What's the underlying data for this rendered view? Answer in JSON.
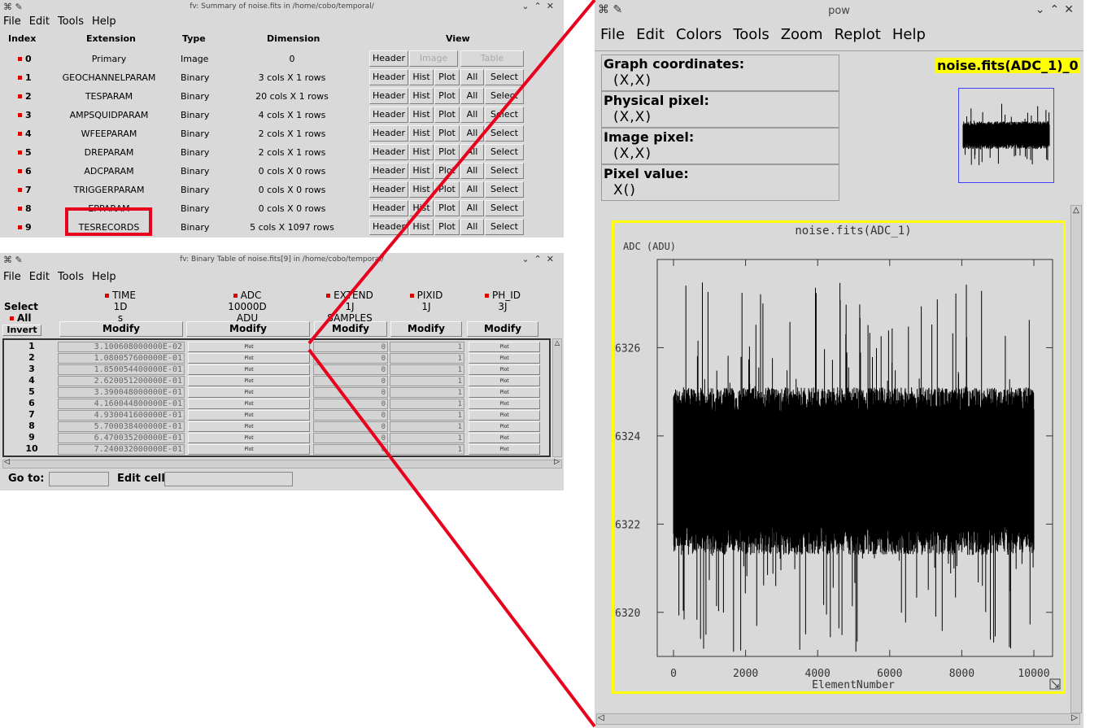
{
  "summary_window": {
    "title": "fv: Summary of noise.fits in /home/cobo/temporal/",
    "menu": [
      "File",
      "Edit",
      "Tools",
      "Help"
    ],
    "headers": {
      "index": "Index",
      "extension": "Extension",
      "type": "Type",
      "dimension": "Dimension",
      "view": "View"
    },
    "rows": [
      {
        "index": "0",
        "extension": "Primary",
        "type": "Image",
        "dimension": "0"
      },
      {
        "index": "1",
        "extension": "GEOCHANNELPARAM",
        "type": "Binary",
        "dimension": "3 cols X 1 rows"
      },
      {
        "index": "2",
        "extension": "TESPARAM",
        "type": "Binary",
        "dimension": "20 cols X 1 rows"
      },
      {
        "index": "3",
        "extension": "AMPSQUIDPARAM",
        "type": "Binary",
        "dimension": "4 cols X 1 rows"
      },
      {
        "index": "4",
        "extension": "WFEEPARAM",
        "type": "Binary",
        "dimension": "2 cols X 1 rows"
      },
      {
        "index": "5",
        "extension": "DREPARAM",
        "type": "Binary",
        "dimension": "2 cols X 1 rows"
      },
      {
        "index": "6",
        "extension": "ADCPARAM",
        "type": "Binary",
        "dimension": "0 cols X 0 rows"
      },
      {
        "index": "7",
        "extension": "TRIGGERPARAM",
        "type": "Binary",
        "dimension": "0 cols X 0 rows"
      },
      {
        "index": "8",
        "extension": "EPPARAM",
        "type": "Binary",
        "dimension": "0 cols X 0 rows"
      },
      {
        "index": "9",
        "extension": "TESRECORDS",
        "type": "Binary",
        "dimension": "5 cols X 1097 rows"
      }
    ],
    "buttons": {
      "header": "Header",
      "image": "Image",
      "table": "Table",
      "hist": "Hist",
      "plot": "Plot",
      "all": "All",
      "select": "Select"
    }
  },
  "table_window": {
    "title": "fv: Binary Table of noise.fits[9] in /home/cobo/temporal/",
    "menu": [
      "File",
      "Edit",
      "Tools",
      "Help"
    ],
    "select_label": "Select",
    "all_label": "All",
    "invert_label": "Invert",
    "modify_label": "Modify",
    "columns": [
      {
        "name": "TIME",
        "format": "1D",
        "unit": "s"
      },
      {
        "name": "ADC",
        "format": "10000D",
        "unit": "ADU"
      },
      {
        "name": "EXTEND",
        "format": "1J",
        "unit": "SAMPLES"
      },
      {
        "name": "PIXID",
        "format": "1J",
        "unit": ""
      },
      {
        "name": "PH_ID",
        "format": "3J",
        "unit": ""
      }
    ],
    "rows": [
      {
        "n": "1",
        "time": "3.100608000000E-02",
        "extend": "0",
        "pixid": "1"
      },
      {
        "n": "2",
        "time": "1.080057600000E-01",
        "extend": "0",
        "pixid": "1"
      },
      {
        "n": "3",
        "time": "1.850054400000E-01",
        "extend": "0",
        "pixid": "1"
      },
      {
        "n": "4",
        "time": "2.620051200000E-01",
        "extend": "0",
        "pixid": "1"
      },
      {
        "n": "5",
        "time": "3.390048000000E-01",
        "extend": "0",
        "pixid": "1"
      },
      {
        "n": "6",
        "time": "4.160044800000E-01",
        "extend": "0",
        "pixid": "1"
      },
      {
        "n": "7",
        "time": "4.930041600000E-01",
        "extend": "0",
        "pixid": "1"
      },
      {
        "n": "8",
        "time": "5.700038400000E-01",
        "extend": "0",
        "pixid": "1"
      },
      {
        "n": "9",
        "time": "6.470035200000E-01",
        "extend": "0",
        "pixid": "1"
      },
      {
        "n": "10",
        "time": "7.240032000000E-01",
        "extend": "0",
        "pixid": "1"
      }
    ],
    "plot_label": "Plot",
    "goto_label": "Go to:",
    "editcell_label": "Edit cell:"
  },
  "pow_window": {
    "title": "pow",
    "menu": [
      "File",
      "Edit",
      "Colors",
      "Tools",
      "Zoom",
      "Replot",
      "Help"
    ],
    "graph_coords_label": "Graph coordinates:",
    "graph_coords_value": "(X,X)",
    "physical_label": "Physical pixel:",
    "physical_value": "(X,X)",
    "image_label": "Image pixel:",
    "image_value": "(X,X)",
    "pixel_value_label": "Pixel value:",
    "pixel_value_value": "X()",
    "graph_tag": "noise.fits(ADC_1)_0"
  },
  "chart_data": {
    "type": "line",
    "title": "noise.fits(ADC_1)",
    "xlabel": "ElementNumber",
    "ylabel": "ADC (ADU)",
    "xlim": [
      0,
      10000
    ],
    "ylim": [
      6319,
      6328
    ],
    "x_ticks": [
      "0",
      "2000",
      "4000",
      "6000",
      "8000",
      "10000"
    ],
    "y_ticks": [
      "6320",
      "6322",
      "6324",
      "6326"
    ],
    "series": [
      {
        "baseline": 6323,
        "band_low": 6322,
        "band_high": 6324.5,
        "spike_min": 6319.1,
        "spike_max": 6327.5,
        "points": 10000
      }
    ]
  },
  "colors": {
    "highlight_red": "#e8001c",
    "plot_border": "#ffff00",
    "tag_bg": "#ffff00",
    "thumb_border": "#4040ff"
  }
}
